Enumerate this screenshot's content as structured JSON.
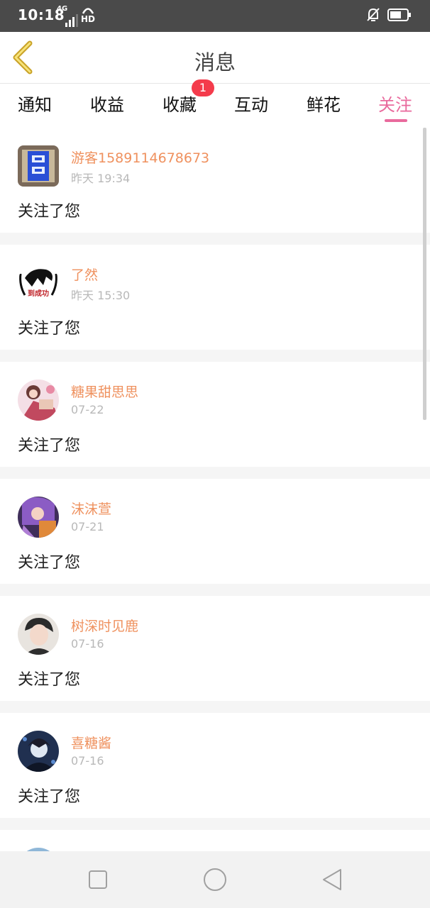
{
  "status_bar": {
    "time": "10:18",
    "signal_label": "4G",
    "network_label": "HD"
  },
  "header": {
    "title": "消息"
  },
  "tabs": [
    {
      "label": "通知"
    },
    {
      "label": "收益"
    },
    {
      "label": "收藏",
      "badge": "1"
    },
    {
      "label": "互动"
    },
    {
      "label": "鲜花"
    },
    {
      "label": "关注",
      "active": true
    }
  ],
  "messages": [
    {
      "username": "游客1589114678673",
      "time": "昨天 19:34",
      "text": "关注了您"
    },
    {
      "username": "了然",
      "time": "昨天 15:30",
      "text": "关注了您"
    },
    {
      "username": "糖果甜思思",
      "time": "07-22",
      "text": "关注了您"
    },
    {
      "username": "沫沫萱",
      "time": "07-21",
      "text": "关注了您"
    },
    {
      "username": "树深时见鹿",
      "time": "07-16",
      "text": "关注了您"
    },
    {
      "username": "喜糖酱",
      "time": "07-16",
      "text": "关注了您"
    }
  ],
  "avatar_text": {
    "2": "到成功"
  },
  "colors": {
    "accent": "#e96a9d",
    "username": "#ef915e",
    "badge": "#f43b4b",
    "back_arrow": "#c9a227",
    "status_bar": "#4a4a4a"
  },
  "icons": {
    "back": "chevron-left-icon",
    "bell_muted": "bell-off-icon",
    "battery": "battery-icon",
    "nav_recent": "square-icon",
    "nav_home": "circle-icon",
    "nav_back": "triangle-back-icon"
  }
}
